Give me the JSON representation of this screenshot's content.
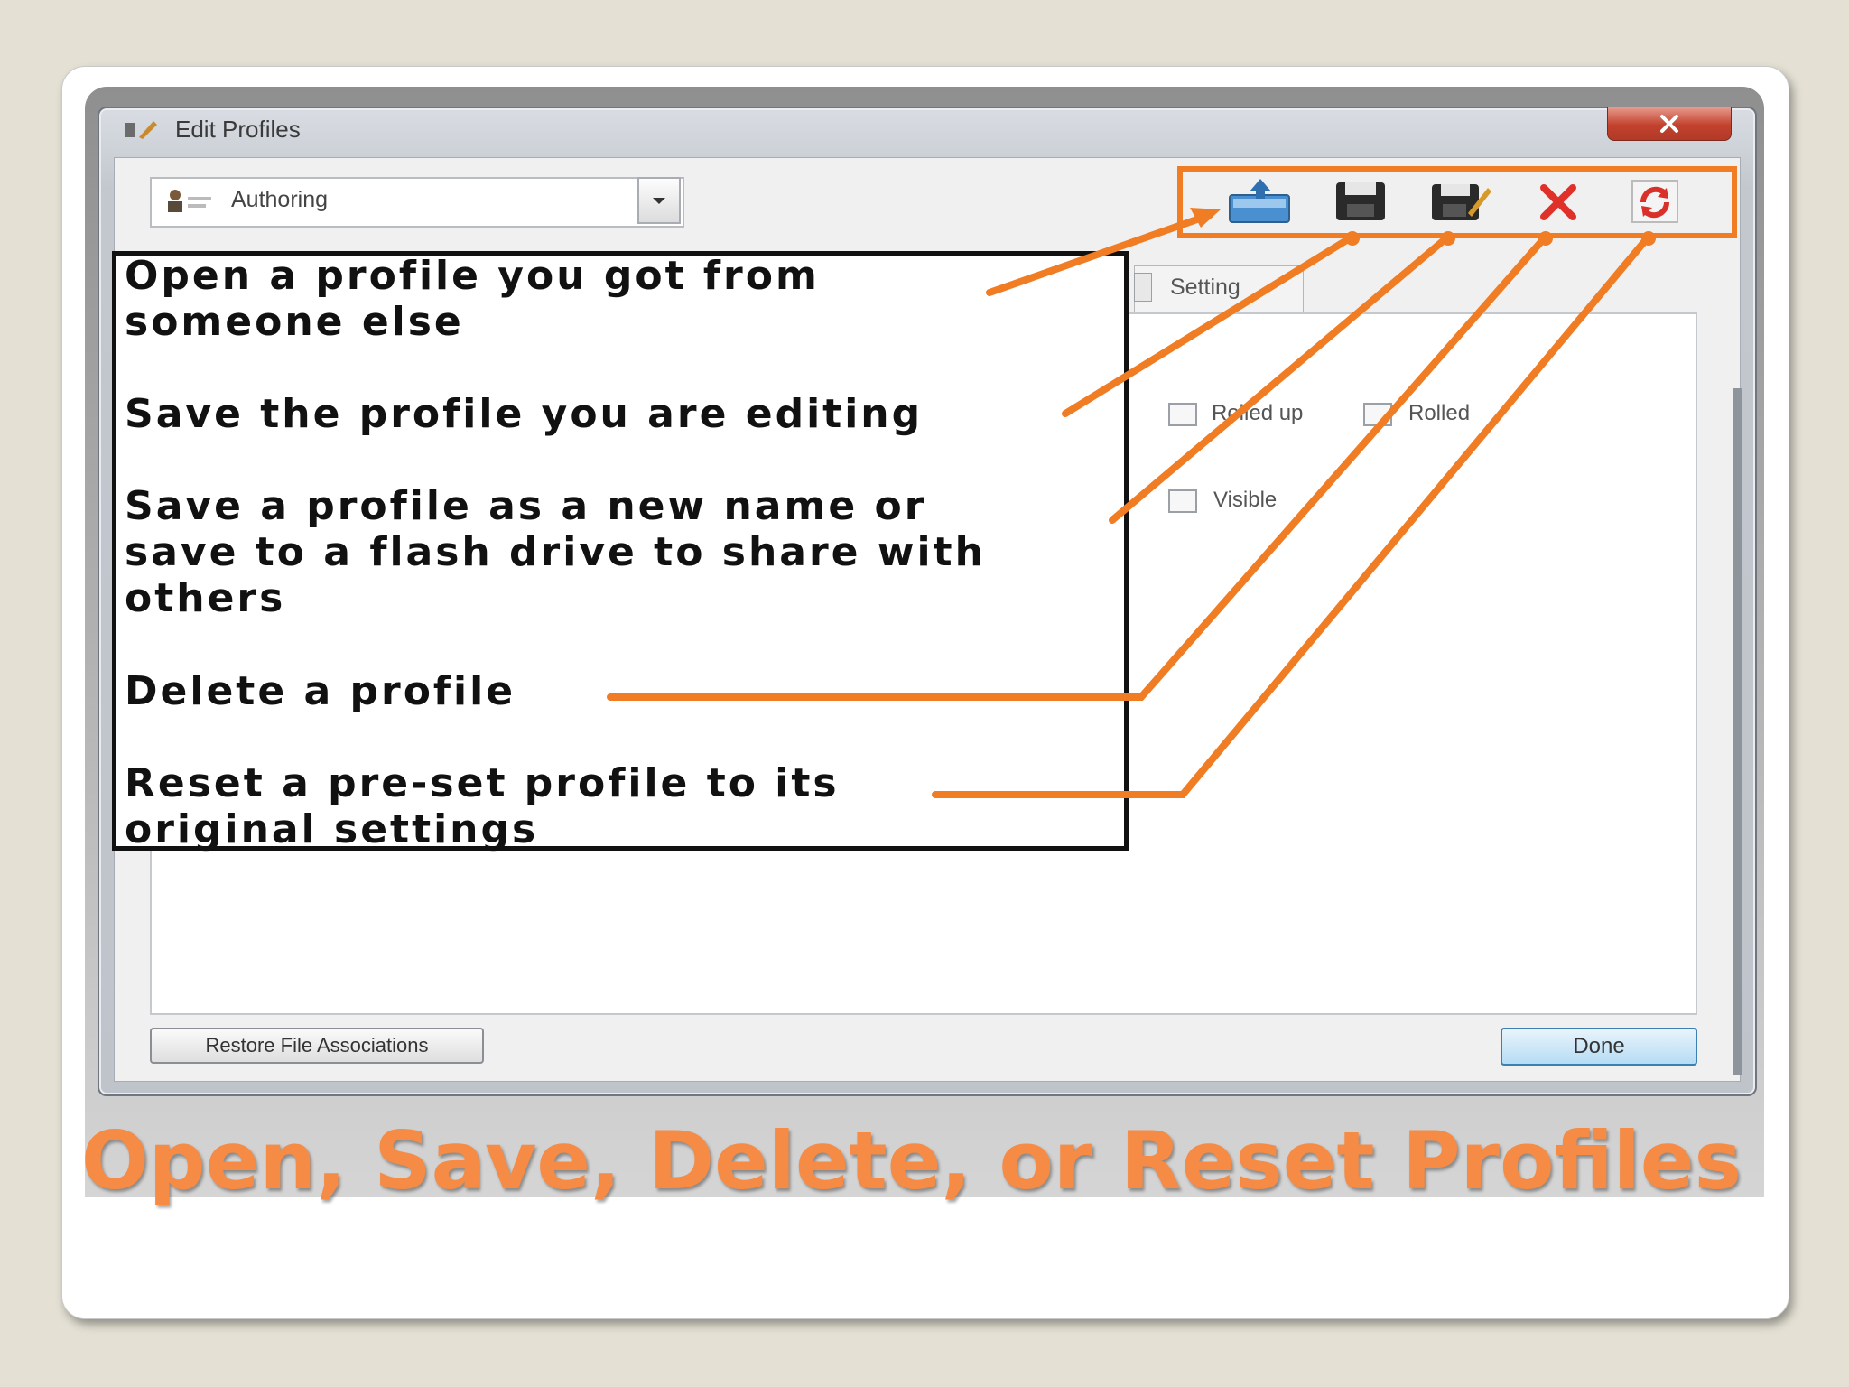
{
  "window": {
    "title": "Edit Profiles"
  },
  "profile_selector": {
    "value": "Authoring"
  },
  "tabs": {
    "settings_partial": "Setting"
  },
  "checkboxes": {
    "rolled_up": "Rolled up",
    "rolled_in": "Rolled",
    "visible": "Visible"
  },
  "buttons": {
    "restore_file_associations": "Restore File Associations",
    "done": "Done"
  },
  "toolbar_icons": [
    "open-profile-icon",
    "save-icon",
    "save-as-icon",
    "delete-icon",
    "reset-icon"
  ],
  "callouts": {
    "open": "Open a profile you got from\nsomeone else",
    "save": "Save the profile you are editing",
    "save_as": "Save a profile as a new name or\nsave to a flash drive to share with\nothers",
    "delete": "Delete a profile",
    "reset": "Reset a pre-set profile to its\noriginal settings"
  },
  "slide_title": "Open, Save, Delete, or Reset Profiles",
  "colors": {
    "accent_orange": "#f07c24",
    "title_orange": "#f58b44",
    "delete_red": "#e0302a"
  }
}
